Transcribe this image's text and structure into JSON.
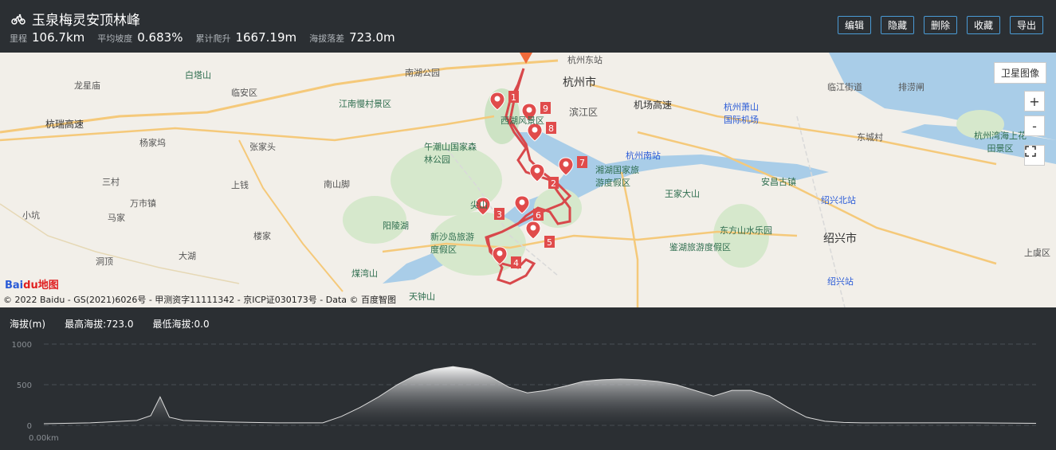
{
  "route": {
    "title": "玉泉梅灵安顶林峰",
    "stats": [
      {
        "label": "里程",
        "value": "106.7km"
      },
      {
        "label": "平均坡度",
        "value": "0.683%"
      },
      {
        "label": "累计爬升",
        "value": "1667.19m"
      },
      {
        "label": "海拔落差",
        "value": "723.0m"
      }
    ]
  },
  "actions": [
    "编辑",
    "隐藏",
    "删除",
    "收藏",
    "导出"
  ],
  "map": {
    "satellite_label": "卫星图像",
    "zoom_in": "+",
    "zoom_out": "-",
    "copyright": "© 2022 Baidu - GS(2021)6026号 - 甲测资字11111342 - 京ICP证030173号 - Data © 百度智图",
    "logo_text": "Bai",
    "logo_tail": "du地图",
    "places": [
      {
        "name": "杭州市",
        "big": true
      },
      {
        "name": "临安区"
      },
      {
        "name": "白塔山"
      },
      {
        "name": "龙星庙"
      },
      {
        "name": "南湖公园"
      },
      {
        "name": "江南慢村景区"
      },
      {
        "name": "杭瑞高速"
      },
      {
        "name": "杨家坞"
      },
      {
        "name": "张家头"
      },
      {
        "name": "午潮山国家森林公园"
      },
      {
        "name": "西湖风景区"
      },
      {
        "name": "滨江区"
      },
      {
        "name": "杭州东站"
      },
      {
        "name": "机场高速"
      },
      {
        "name": "杭州萧山国际机场"
      },
      {
        "name": "临江街道"
      },
      {
        "name": "排涝闸"
      },
      {
        "name": "杭州南站"
      },
      {
        "name": "湘湖国家旅游度假区"
      },
      {
        "name": "王家大山"
      },
      {
        "name": "安昌古镇"
      },
      {
        "name": "绍兴北站"
      },
      {
        "name": "东方山水乐园"
      },
      {
        "name": "绍兴市",
        "big": true
      },
      {
        "name": "鉴湖旅游度假区"
      },
      {
        "name": "绍兴站"
      },
      {
        "name": "阳陵湖"
      },
      {
        "name": "新沙岛旅游度假区"
      },
      {
        "name": "煤湾山"
      },
      {
        "name": "天钟山"
      },
      {
        "name": "万市镇"
      },
      {
        "name": "马家"
      },
      {
        "name": "上钱"
      },
      {
        "name": "南山脚"
      },
      {
        "name": "楼家"
      },
      {
        "name": "大湖"
      },
      {
        "name": "洞顶"
      },
      {
        "name": "杭州湾海上花田景区"
      },
      {
        "name": "东城村"
      },
      {
        "name": "上虞区"
      },
      {
        "name": "尖山"
      },
      {
        "name": "小坑"
      },
      {
        "name": "三村"
      }
    ],
    "waypoints": [
      "1",
      "2",
      "3",
      "4",
      "5",
      "6",
      "7",
      "8",
      "9"
    ]
  },
  "elevation": {
    "label": "海拔(m)",
    "max_label": "最高海拔:723.0",
    "min_label": "最低海拔:0.0",
    "y_ticks": [
      "1000",
      "500",
      "0"
    ],
    "x_start": "0.00km"
  },
  "chart_data": {
    "type": "area",
    "title": "",
    "xlabel": "",
    "ylabel": "海拔(m)",
    "ylim": [
      0,
      1000
    ],
    "xlim": [
      0,
      106.7
    ],
    "x": [
      0,
      5,
      10,
      11.5,
      12.5,
      13.5,
      15,
      20,
      25,
      30,
      32,
      34,
      36,
      38,
      40,
      42,
      44,
      46,
      48,
      50,
      52,
      54,
      56,
      58,
      60,
      62,
      64,
      66,
      68,
      70,
      72,
      74,
      76,
      78,
      80,
      82,
      84,
      86,
      88,
      90,
      95,
      100,
      106.7
    ],
    "values": [
      20,
      30,
      60,
      120,
      350,
      100,
      60,
      40,
      30,
      30,
      110,
      220,
      350,
      500,
      620,
      690,
      723,
      690,
      600,
      470,
      400,
      430,
      480,
      540,
      560,
      570,
      560,
      540,
      500,
      430,
      360,
      430,
      430,
      360,
      220,
      100,
      50,
      35,
      30,
      30,
      30,
      30,
      25
    ]
  }
}
